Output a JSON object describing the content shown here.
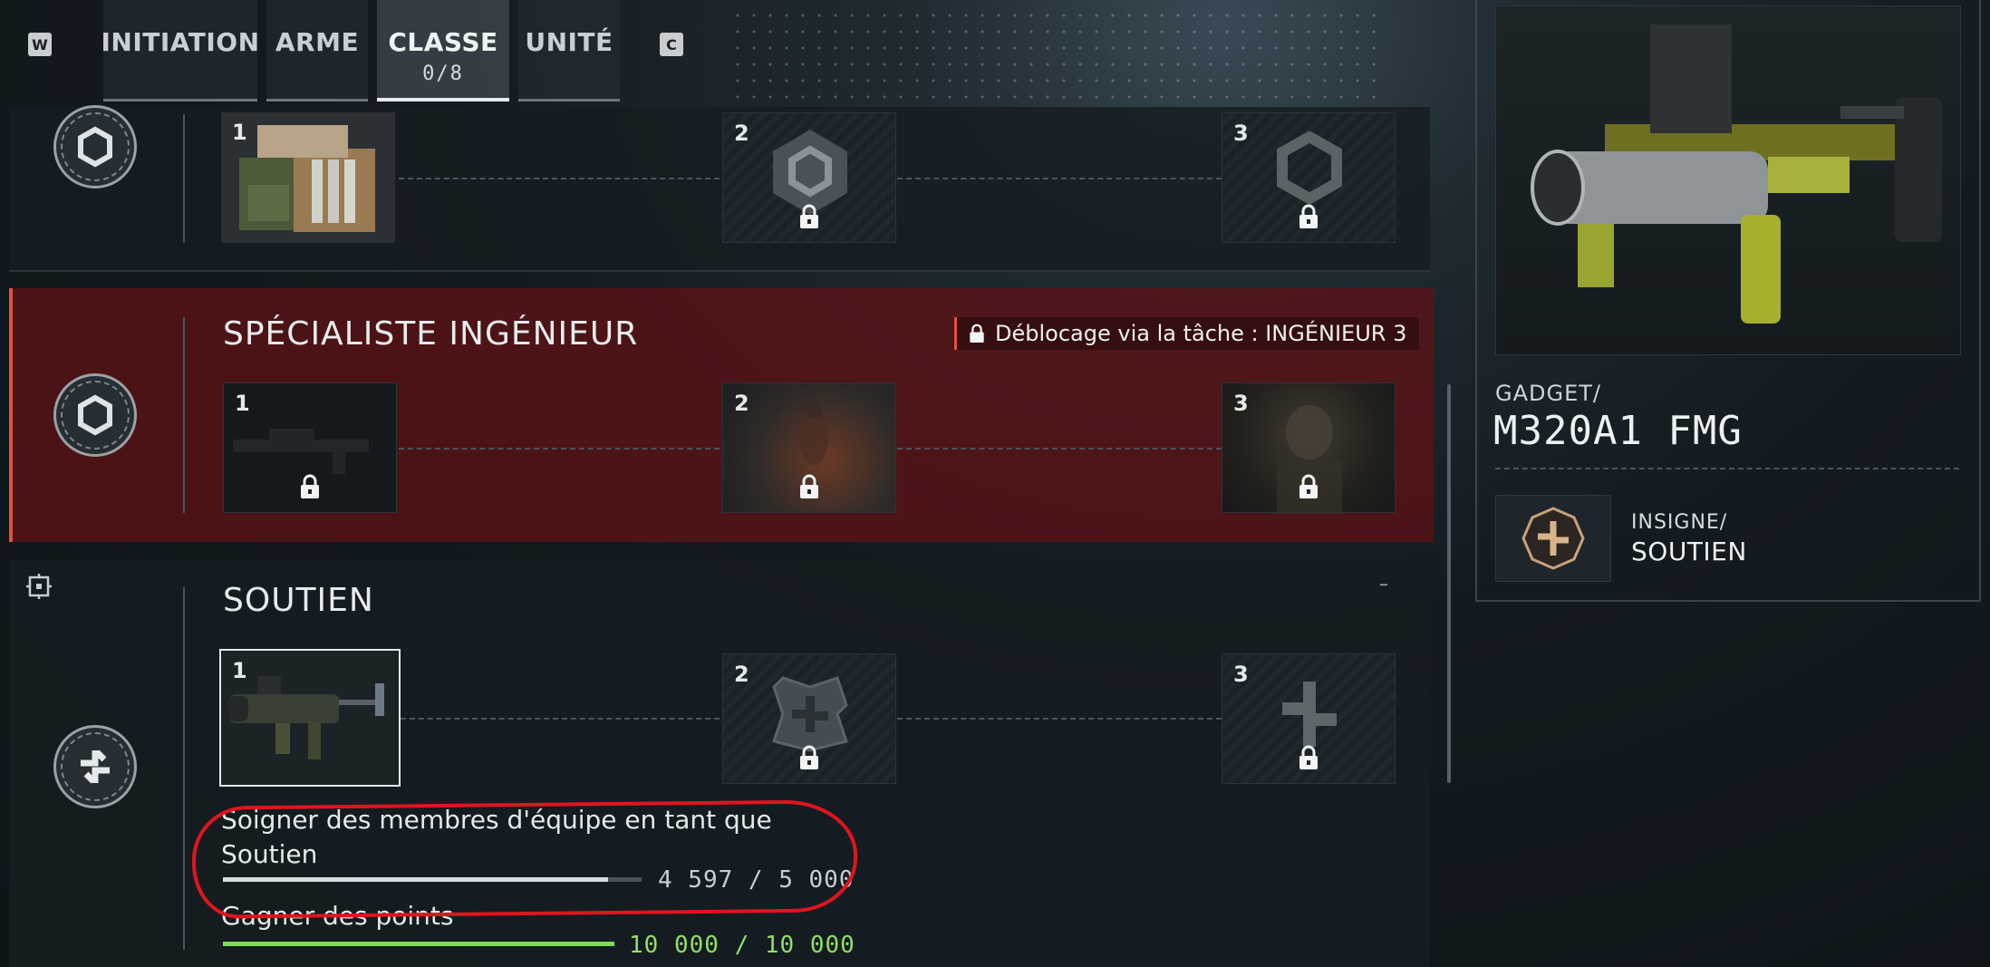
{
  "tabs": {
    "left_key": "W",
    "right_key": "C",
    "items": [
      {
        "label": "INITIATION"
      },
      {
        "label": "ARME"
      },
      {
        "label": "CLASSE",
        "count": "0/8"
      },
      {
        "label": "UNITÉ"
      }
    ]
  },
  "sections": {
    "first": {
      "slots": [
        "1",
        "2",
        "3"
      ]
    },
    "engineer": {
      "title": "SPÉCIALISTE INGÉNIEUR",
      "unlock": "Déblocage via la tâche : INGÉNIEUR 3",
      "slots": [
        "1",
        "2",
        "3"
      ]
    },
    "support": {
      "title": "SOUTIEN",
      "collapse": "–",
      "slots": [
        "1",
        "2",
        "3"
      ],
      "tasks": [
        {
          "label": "Soigner des membres d'équipe en tant que Soutien",
          "value": "4 597 / 5 000",
          "progress": 0.919
        },
        {
          "label": "Gagner des points",
          "value": "10 000 / 10 000",
          "progress": 1.0
        }
      ]
    }
  },
  "detail": {
    "type": "GADGET/",
    "name": "M320A1 FMG",
    "insignia_label": "INSIGNE/",
    "insignia_name": "SOUTIEN"
  },
  "colors": {
    "accent_red": "#e0523c",
    "progress_white": "#d8dcde",
    "progress_green": "#7ed957",
    "annotation": "#e0141e"
  }
}
